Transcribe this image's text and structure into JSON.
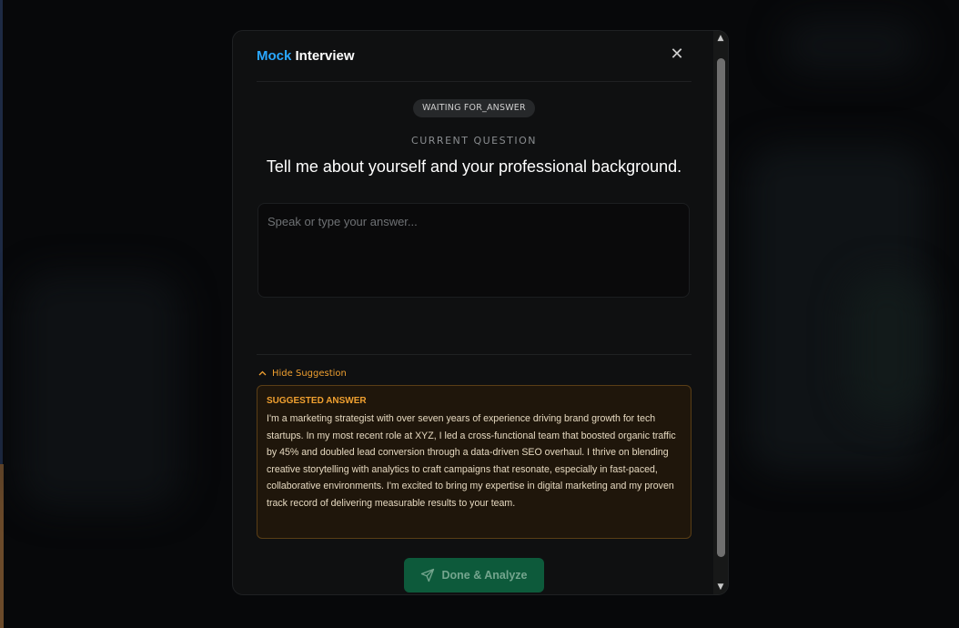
{
  "modal": {
    "title_accent": "Mock",
    "title_rest": "Interview",
    "close_glyph": "✕"
  },
  "status": {
    "badge": "WAITING FOR_ANSWER"
  },
  "question": {
    "label": "CURRENT QUESTION",
    "text": "Tell me about yourself and your professional background."
  },
  "answer": {
    "placeholder": "Speak or type your answer...",
    "value": ""
  },
  "suggestion": {
    "toggle_label": "Hide Suggestion",
    "title": "SUGGESTED ANSWER",
    "text": "I'm a marketing strategist with over seven years of experience driving brand growth for tech startups. In my most recent role at XYZ, I led a cross-functional team that boosted organic traffic by 45% and doubled lead conversion through a data-driven SEO overhaul. I thrive on blending creative storytelling with analytics to craft campaigns that resonate, especially in fast-paced, collaborative environments. I'm excited to bring my expertise in digital marketing and my proven track record of delivering measurable results to your team."
  },
  "actions": {
    "done_label": "Done & Analyze",
    "done_icon": "send-icon"
  },
  "colors": {
    "accent": "#2aa7ff",
    "suggest": "#f0a030",
    "done_bg": "#0d5a3b"
  }
}
